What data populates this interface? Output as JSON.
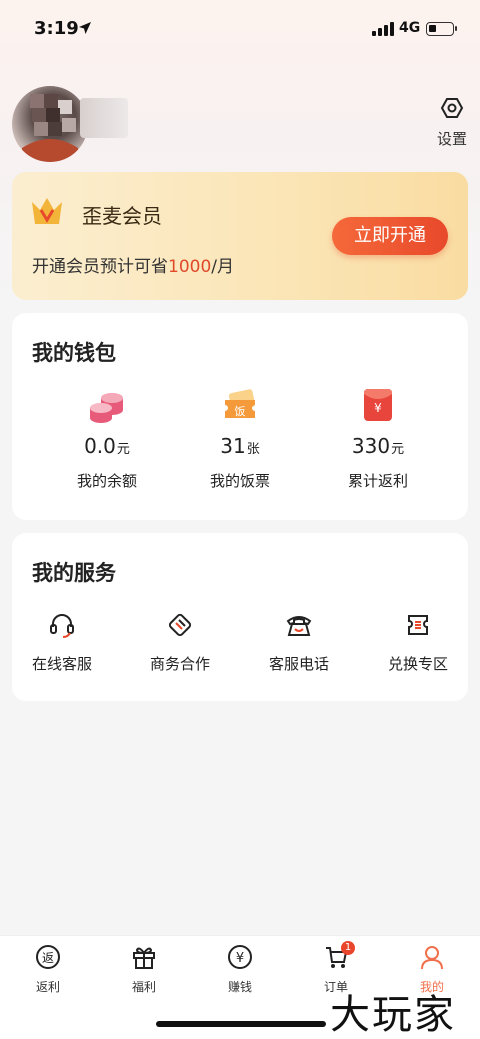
{
  "status_bar": {
    "time": "3:19",
    "network": "4G"
  },
  "header": {
    "settings_label": "设置"
  },
  "member": {
    "title": "歪麦会员",
    "desc_prefix": "开通会员预计可省",
    "desc_highlight": "1000",
    "desc_suffix": "/月",
    "button_label": "立即开通"
  },
  "wallet": {
    "title": "我的钱包",
    "items": [
      {
        "value": "0.0",
        "unit": "元",
        "label": "我的余额",
        "icon": "coins-icon"
      },
      {
        "value": "31",
        "unit": "张",
        "label": "我的饭票",
        "icon": "meal-ticket-icon"
      },
      {
        "value": "330",
        "unit": "元",
        "label": "累计返利",
        "icon": "red-envelope-icon"
      }
    ]
  },
  "services": {
    "title": "我的服务",
    "items": [
      {
        "label": "在线客服",
        "icon": "headset-icon"
      },
      {
        "label": "商务合作",
        "icon": "handshake-icon"
      },
      {
        "label": "客服电话",
        "icon": "telephone-icon"
      },
      {
        "label": "兑换专区",
        "icon": "exchange-ticket-icon"
      }
    ]
  },
  "tabs": [
    {
      "label": "返利",
      "icon": "rebate-icon",
      "glyph": "返"
    },
    {
      "label": "福利",
      "icon": "gift-icon"
    },
    {
      "label": "赚钱",
      "icon": "yuan-icon",
      "glyph": "¥"
    },
    {
      "label": "订单",
      "icon": "cart-icon",
      "badge": "1"
    },
    {
      "label": "我的",
      "icon": "profile-icon",
      "active": true
    }
  ],
  "watermark": "大玩家",
  "colors": {
    "accent": "#e8492b",
    "active_tab": "#f0704b",
    "card_gold": "#fbe5b6",
    "wallet_pink": "#e85a7a"
  }
}
